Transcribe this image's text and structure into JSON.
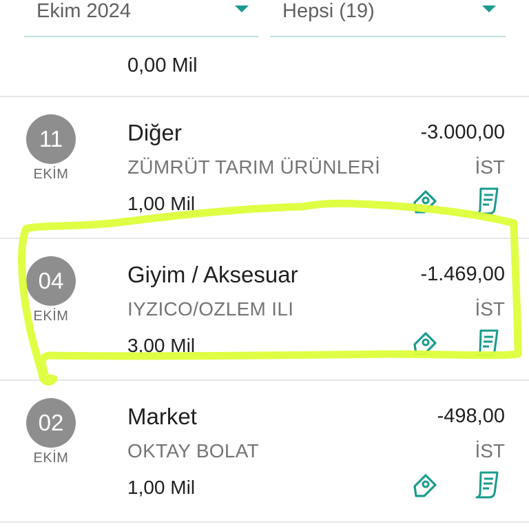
{
  "filters": {
    "month": "Ekim 2024",
    "category_filter": "Hepsi (19)"
  },
  "summary": {
    "total_points": "0,00 Mil"
  },
  "transactions": [
    {
      "day": "11",
      "month": "EKİM",
      "category": "Diğer",
      "amount": "-3.000,00",
      "merchant": "ZÜMRÜT TARIM ÜRÜNLERİ",
      "city": "İST",
      "points": "1,00 Mil"
    },
    {
      "day": "04",
      "month": "EKİM",
      "category": "Giyim / Aksesuar",
      "amount": "-1.469,00",
      "merchant": "IYZICO/OZLEM ILI",
      "city": "İST",
      "points": "3,00 Mil"
    },
    {
      "day": "02",
      "month": "EKİM",
      "category": "Market",
      "amount": "-498,00",
      "merchant": "OKTAY BOLAT",
      "city": "İST",
      "points": "1,00 Mil"
    }
  ],
  "colors": {
    "accent": "#1a9b8c",
    "date_circle": "#8e8e8e",
    "highlight_marker": "#dcff3a"
  },
  "icons": {
    "tag": "tag-icon",
    "receipt": "receipt-icon"
  }
}
